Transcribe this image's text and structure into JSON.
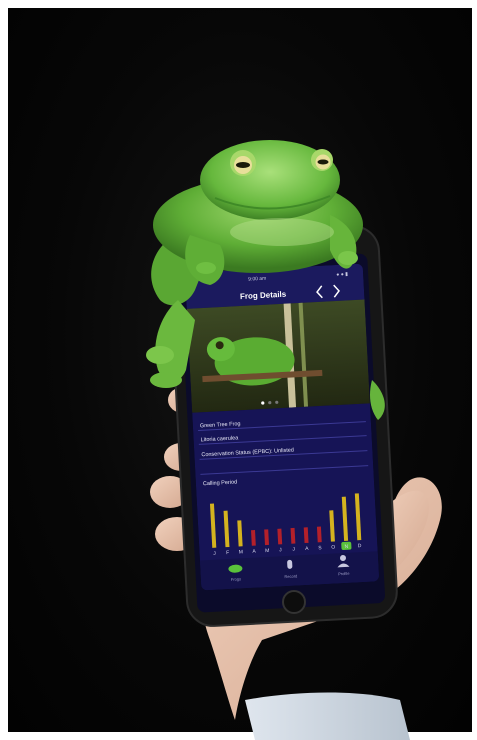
{
  "scene": {
    "description_subject": "frog on smartphone"
  },
  "phone": {
    "status_time": "9:00 am",
    "status_right": "● ● ▮",
    "header_title": "Frog Details",
    "prev_icon": "chevron-left-icon",
    "next_icon": "chevron-right-icon",
    "info_rows": [
      "Green Tree Frog",
      "Litoria caerulea",
      "Conservation Status (EPBC): Unlisted"
    ],
    "calling_label": "Calling Period",
    "months": [
      "J",
      "F",
      "M",
      "A",
      "M",
      "J",
      "J",
      "A",
      "S",
      "O",
      "N",
      "D"
    ],
    "calling_levels": [
      0.85,
      0.7,
      0.5,
      0.3,
      0.3,
      0.3,
      0.3,
      0.3,
      0.3,
      0.6,
      0.85,
      0.9
    ],
    "selected_month_index": 10,
    "colors": {
      "header_bg": "#1b1a5e",
      "panel_bg": "#161456",
      "bar_active": "#d4b21f",
      "bar_inactive": "#b3202a",
      "selected_month": "#5ac23b",
      "frog_green": "#62b33a"
    },
    "tabs": [
      {
        "label": "Frogs",
        "icon": "frog-icon"
      },
      {
        "label": "Record",
        "icon": "microphone-icon"
      },
      {
        "label": "Profile",
        "icon": "person-icon"
      }
    ]
  }
}
